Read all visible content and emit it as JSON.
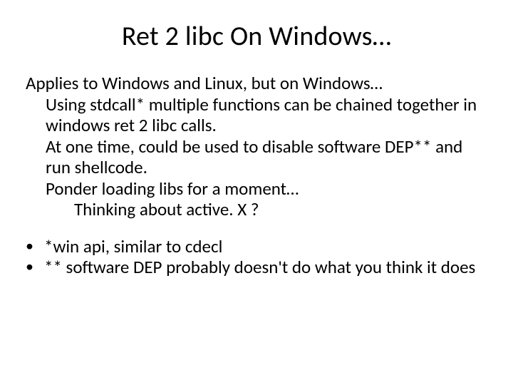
{
  "title": "Ret 2 libc On Windows…",
  "body": {
    "p0": "Applies to Windows and Linux, but on Windows…",
    "p1": "Using stdcall* multiple functions can be chained together in windows ret 2 libc calls.",
    "p2": "At one time, could be used to disable software DEP** and run shellcode.",
    "p3": "Ponder loading libs for a moment…",
    "p4": "Thinking about active. X ?"
  },
  "bullets": {
    "b1": "*win api, similar to cdecl",
    "b2": "** software DEP probably doesn't do what you think it does"
  }
}
